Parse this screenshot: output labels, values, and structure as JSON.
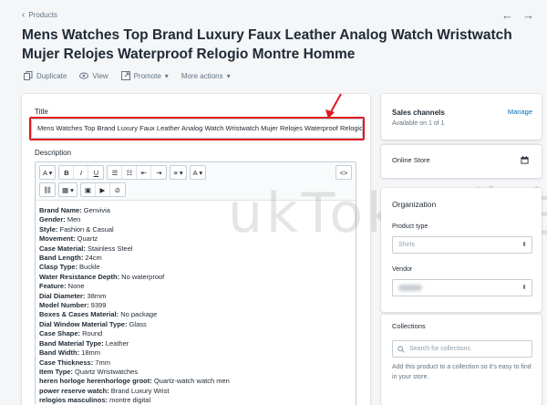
{
  "breadcrumb": {
    "label": "Products"
  },
  "page": {
    "title": "Mens Watches Top Brand Luxury Faux Leather Analog Watch Wristwatch Mujer Relojes Waterproof Relogio Montre Homme"
  },
  "actions": {
    "duplicate": "Duplicate",
    "view": "View",
    "promote": "Promote",
    "more": "More actions"
  },
  "product": {
    "title_label": "Title",
    "title_value": "Mens Watches Top Brand Luxury Faux Leather Analog Watch Wristwatch Mujer Relojes Waterproof Relogio Montre Homme",
    "description_label": "Description",
    "specs": [
      {
        "k": "Brand Name:",
        "v": " Genvivia"
      },
      {
        "k": "Gender:",
        "v": " Men"
      },
      {
        "k": "Style:",
        "v": " Fashion & Casual"
      },
      {
        "k": "Movement:",
        "v": " Quartz"
      },
      {
        "k": "Case Material:",
        "v": " Stainless Steel"
      },
      {
        "k": "Band Length:",
        "v": " 24cm"
      },
      {
        "k": "Clasp Type:",
        "v": " Buckle"
      },
      {
        "k": "Water Resistance Depth:",
        "v": " No waterproof"
      },
      {
        "k": "Feature:",
        "v": " None"
      },
      {
        "k": "Dial Diameter:",
        "v": " 38mm"
      },
      {
        "k": "Model Number:",
        "v": " 9399"
      },
      {
        "k": "Boxes & Cases Material:",
        "v": " No package"
      },
      {
        "k": "Dial Window Material Type:",
        "v": " Glass"
      },
      {
        "k": "Case Shape:",
        "v": " Round"
      },
      {
        "k": "Band Material Type:",
        "v": " Leather"
      },
      {
        "k": "Band Width:",
        "v": " 18mm"
      },
      {
        "k": "Case Thickness:",
        "v": " 7mm"
      },
      {
        "k": "Item Type:",
        "v": " Quartz Wristwatches"
      },
      {
        "k": "heren horloge herenhorloge groot:",
        "v": " Quartz-watch watch men"
      },
      {
        "k": "power reserve watch:",
        "v": " Brand Luxury Wrist"
      },
      {
        "k": "relogios masculinos:",
        "v": " montre digital"
      }
    ]
  },
  "toolbar": {
    "row1": [
      "A",
      "B",
      "I",
      "U",
      "≡",
      "≡",
      "⇤",
      "⇥",
      "≡",
      "A"
    ],
    "html": "<>",
    "row2": [
      "🔗",
      "▦",
      "▣",
      "▶",
      "⊘"
    ]
  },
  "sales": {
    "title": "Sales channels",
    "manage": "Manage",
    "available": "Available on 1 of 1",
    "online_store": "Online Store"
  },
  "organization": {
    "title": "Organization",
    "type_label": "Product type",
    "type_value": "Shirts",
    "vendor_label": "Vendor"
  },
  "collections": {
    "title": "Collections",
    "placeholder": "Search for collections",
    "hint": "Add this product to a collection so it's easy to find in your store."
  },
  "watermark": "ukTok Z先生",
  "colors": {
    "accent": "#006fbb",
    "highlight": "#e0191f"
  }
}
